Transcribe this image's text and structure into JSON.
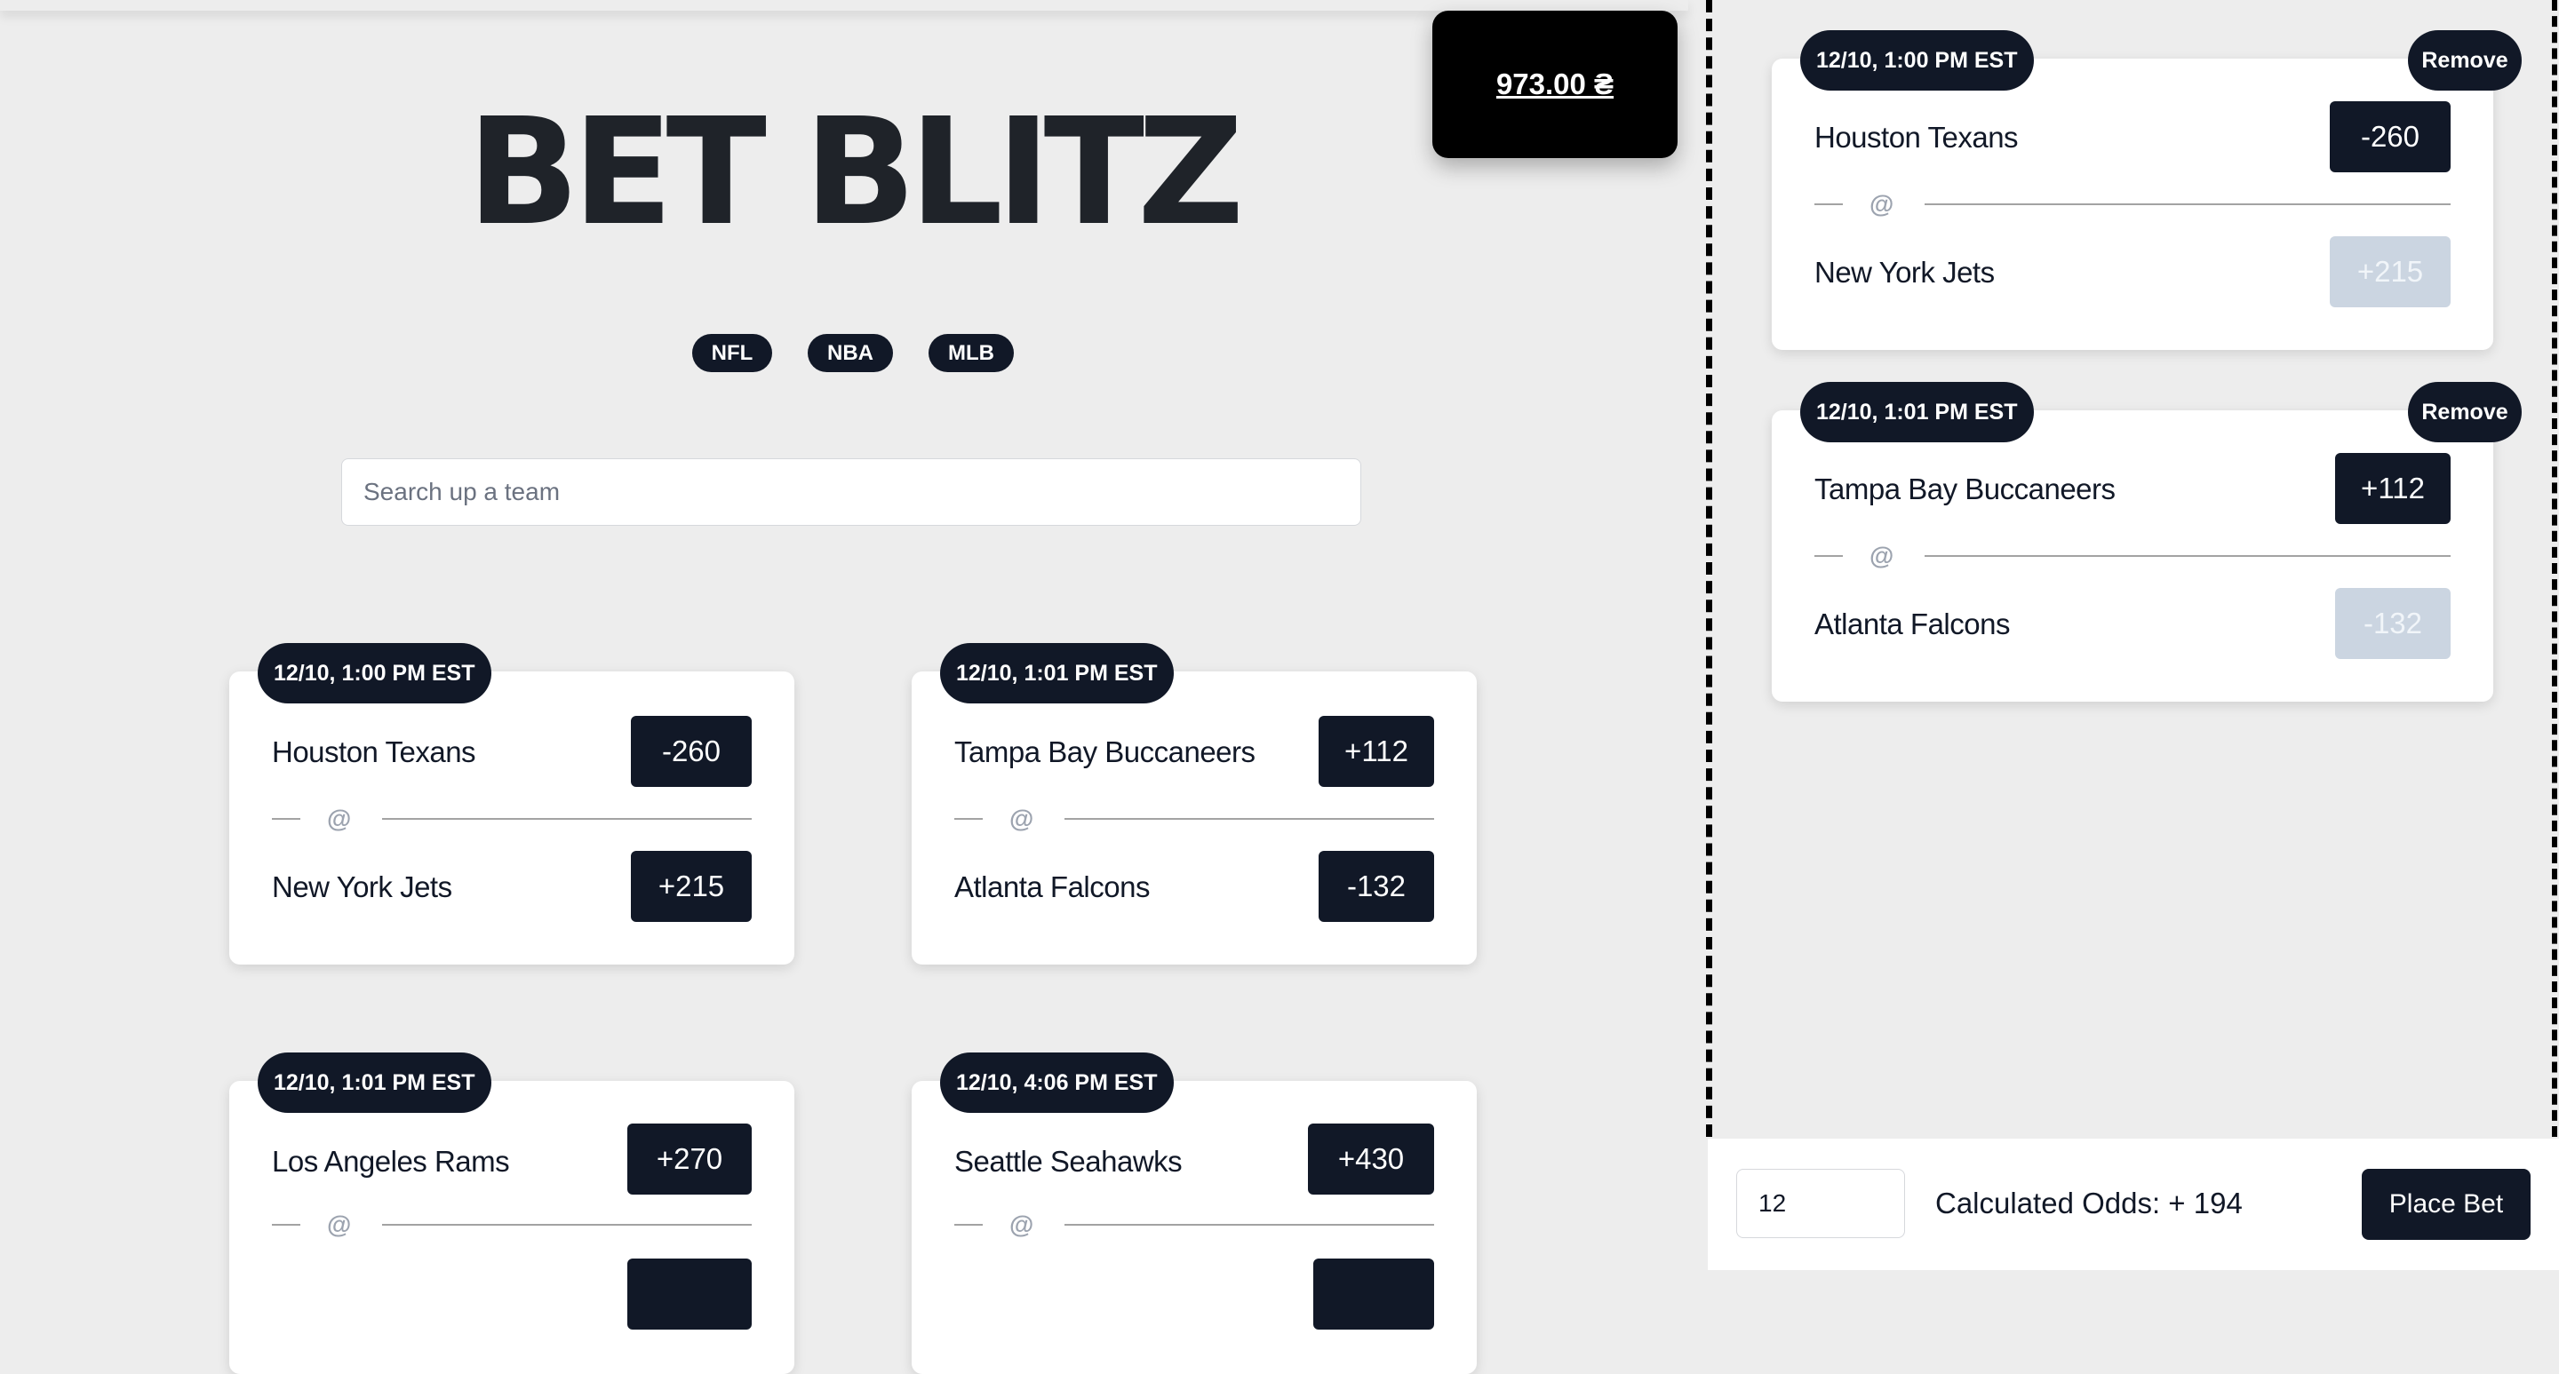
{
  "balance": {
    "amount": "973.00 ₴"
  },
  "title": "BET BLITZ",
  "leagues": [
    "NFL",
    "NBA",
    "MLB"
  ],
  "search": {
    "placeholder": "Search up a team",
    "value": ""
  },
  "games": [
    {
      "time": "12/10, 1:00 PM EST",
      "away": "Houston Texans",
      "away_odds": "-260",
      "home": "New York Jets",
      "home_odds": "+215"
    },
    {
      "time": "12/10, 1:01 PM EST",
      "away": "Tampa Bay Buccaneers",
      "away_odds": "+112",
      "home": "Atlanta Falcons",
      "home_odds": "-132"
    },
    {
      "time": "12/10, 1:01 PM EST",
      "away": "Los Angeles Rams",
      "away_odds": "+270",
      "home": "",
      "home_odds": ""
    },
    {
      "time": "12/10, 4:06 PM EST",
      "away": "Seattle Seahawks",
      "away_odds": "+430",
      "home": "",
      "home_odds": ""
    }
  ],
  "separator": {
    "at": "@"
  },
  "betslip": {
    "remove_label": "Remove",
    "items": [
      {
        "time": "12/10, 1:00 PM EST",
        "away": "Houston Texans",
        "away_odds": "-260",
        "home": "New York Jets",
        "home_odds": "+215"
      },
      {
        "time": "12/10, 1:01 PM EST",
        "away": "Tampa Bay Buccaneers",
        "away_odds": "+112",
        "home": "Atlanta Falcons",
        "home_odds": "-132"
      }
    ],
    "wager_value": "12",
    "calculated_odds": "Calculated Odds: + 194",
    "place_label": "Place Bet"
  }
}
